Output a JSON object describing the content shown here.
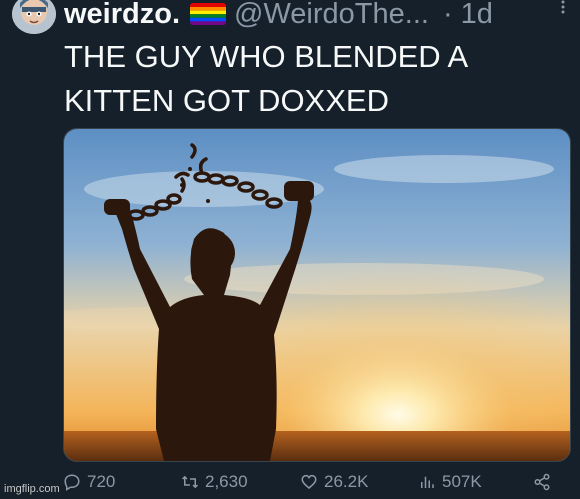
{
  "tweet": {
    "display_name": "weirdzo.",
    "handle": "@WeirdoThe...",
    "time": "· 1d",
    "more_icon": "more-dots-icon",
    "text": "THE GUY WHO BLENDED A KITTEN GOT DOXXED"
  },
  "actions": {
    "replies": "720",
    "retweets": "2,630",
    "likes": "26.2K",
    "views": "507K"
  },
  "watermark": "imgflip.com",
  "colors": {
    "background": "#15202b",
    "text": "#f7f9f9",
    "muted": "#8b98a5"
  }
}
